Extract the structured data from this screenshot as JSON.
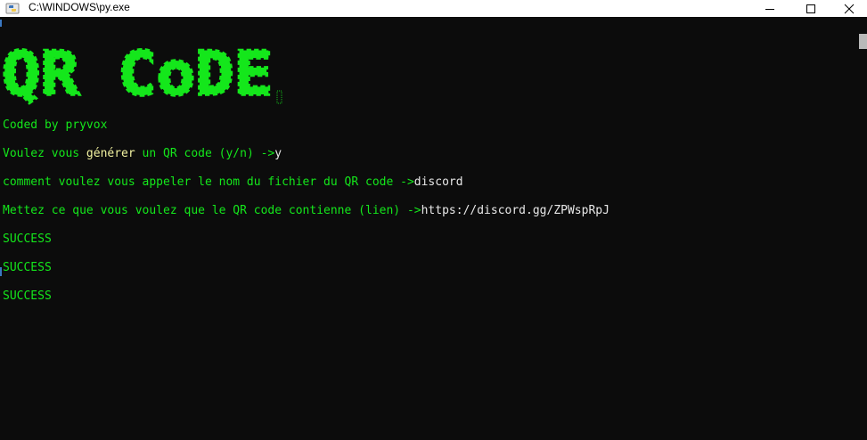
{
  "window": {
    "title": "C:\\WINDOWS\\py.exe",
    "controls": [
      "minimize",
      "maximize",
      "close"
    ]
  },
  "console": {
    "banner_text": "QR CoDE",
    "lines": [
      {
        "parts": [
          {
            "text": "Coded by pryvox",
            "color": "green"
          }
        ]
      },
      {
        "parts": [
          {
            "text": "Voulez vous ",
            "color": "green"
          },
          {
            "text": "générer",
            "color": "yellow"
          },
          {
            "text": " un QR code (y/n) ->",
            "color": "green"
          },
          {
            "text": "y",
            "color": "white"
          }
        ]
      },
      {
        "parts": [
          {
            "text": "comment voulez vous appeler le nom du fichier du QR code ->",
            "color": "green"
          },
          {
            "text": "discord",
            "color": "white"
          }
        ]
      },
      {
        "parts": [
          {
            "text": "Mettez ce que vous voulez que le QR code contienne (lien) ->",
            "color": "green"
          },
          {
            "text": "https://discord.gg/ZPWspRpJ",
            "color": "white"
          }
        ]
      },
      {
        "parts": [
          {
            "text": "SUCCESS",
            "color": "green"
          }
        ]
      },
      {
        "parts": [
          {
            "text": "SUCCESS",
            "color": "green"
          }
        ]
      },
      {
        "parts": [
          {
            "text": "SUCCESS",
            "color": "green"
          }
        ]
      }
    ]
  },
  "colors": {
    "green": "#14e71b",
    "yellow": "#f2f2a0",
    "white": "#e8e8e8",
    "background": "#0c0c0c"
  }
}
